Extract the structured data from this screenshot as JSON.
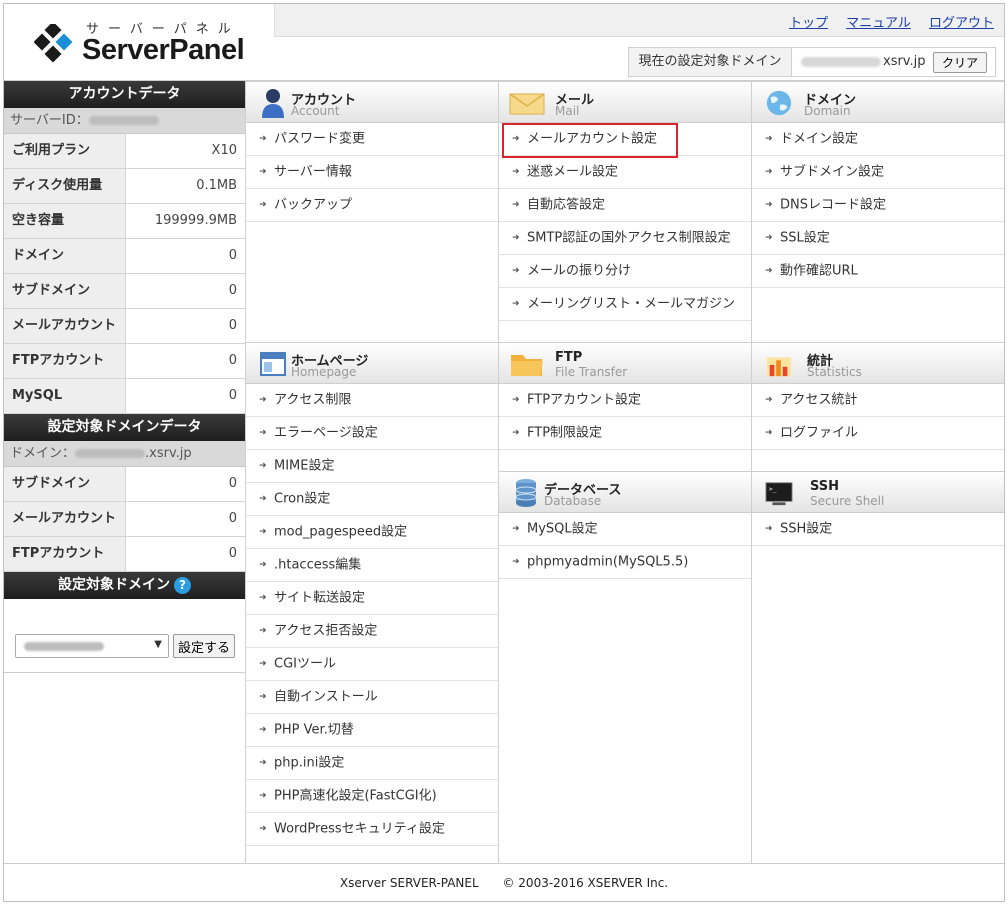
{
  "logo": {
    "kana": "サーバーパネル",
    "wordmark": "ServerPanel"
  },
  "toplinks": [
    "トップ",
    "マニュアル",
    "ログアウト"
  ],
  "domainbox": {
    "label": "現在の設定対象ドメイン",
    "suffix": "xsrv.jp",
    "clear": "クリア"
  },
  "sidebar": {
    "account_title": "アカウントデータ",
    "server_id_label": "サーバーID：",
    "account_rows": [
      {
        "k": "ご利用プラン",
        "v": "X10"
      },
      {
        "k": "ディスク使用量",
        "v": "0.1MB"
      },
      {
        "k": "空き容量",
        "v": "199999.9MB"
      },
      {
        "k": "ドメイン",
        "v": "0"
      },
      {
        "k": "サブドメイン",
        "v": "0"
      },
      {
        "k": "メールアカウント",
        "v": "0"
      },
      {
        "k": "FTPアカウント",
        "v": "0"
      },
      {
        "k": "MySQL",
        "v": "0"
      }
    ],
    "domain_data_title": "設定対象ドメインデータ",
    "domain_label": "ドメイン：",
    "domain_suffix": ".xsrv.jp",
    "domain_rows": [
      {
        "k": "サブドメイン",
        "v": "0"
      },
      {
        "k": "メールアカウント",
        "v": "0"
      },
      {
        "k": "FTPアカウント",
        "v": "0"
      }
    ],
    "target_domain_title": "設定対象ドメイン",
    "help": "?",
    "set_button": "設定する"
  },
  "sections": {
    "account": {
      "jp": "アカウント",
      "en": "Account",
      "items": [
        "パスワード変更",
        "サーバー情報",
        "バックアップ"
      ]
    },
    "mail": {
      "jp": "メール",
      "en": "Mail",
      "items": [
        "メールアカウント設定",
        "迷惑メール設定",
        "自動応答設定",
        "SMTP認証の国外アクセス制限設定",
        "メールの振り分け",
        "メーリングリスト・メールマガジン"
      ]
    },
    "domain": {
      "jp": "ドメイン",
      "en": "Domain",
      "items": [
        "ドメイン設定",
        "サブドメイン設定",
        "DNSレコード設定",
        "SSL設定",
        "動作確認URL"
      ]
    },
    "homepage": {
      "jp": "ホームページ",
      "en": "Homepage",
      "items": [
        "アクセス制限",
        "エラーページ設定",
        "MIME設定",
        "Cron設定",
        "mod_pagespeed設定",
        ".htaccess編集",
        "サイト転送設定",
        "アクセス拒否設定",
        "CGIツール",
        "自動インストール",
        "PHP Ver.切替",
        "php.ini設定",
        "PHP高速化設定(FastCGI化)",
        "WordPressセキュリティ設定"
      ]
    },
    "ftp": {
      "jp": "FTP",
      "en": "File Transfer",
      "items": [
        "FTPアカウント設定",
        "FTP制限設定"
      ]
    },
    "database": {
      "jp": "データベース",
      "en": "Database",
      "items": [
        "MySQL設定",
        "phpmyadmin(MySQL5.5)"
      ]
    },
    "stats": {
      "jp": "統計",
      "en": "Statistics",
      "items": [
        "アクセス統計",
        "ログファイル"
      ]
    },
    "ssh": {
      "jp": "SSH",
      "en": "Secure Shell",
      "items": [
        "SSH設定"
      ]
    }
  },
  "footer": {
    "product": "Xserver SERVER-PANEL",
    "copyright": "© 2003-2016 XSERVER Inc."
  }
}
